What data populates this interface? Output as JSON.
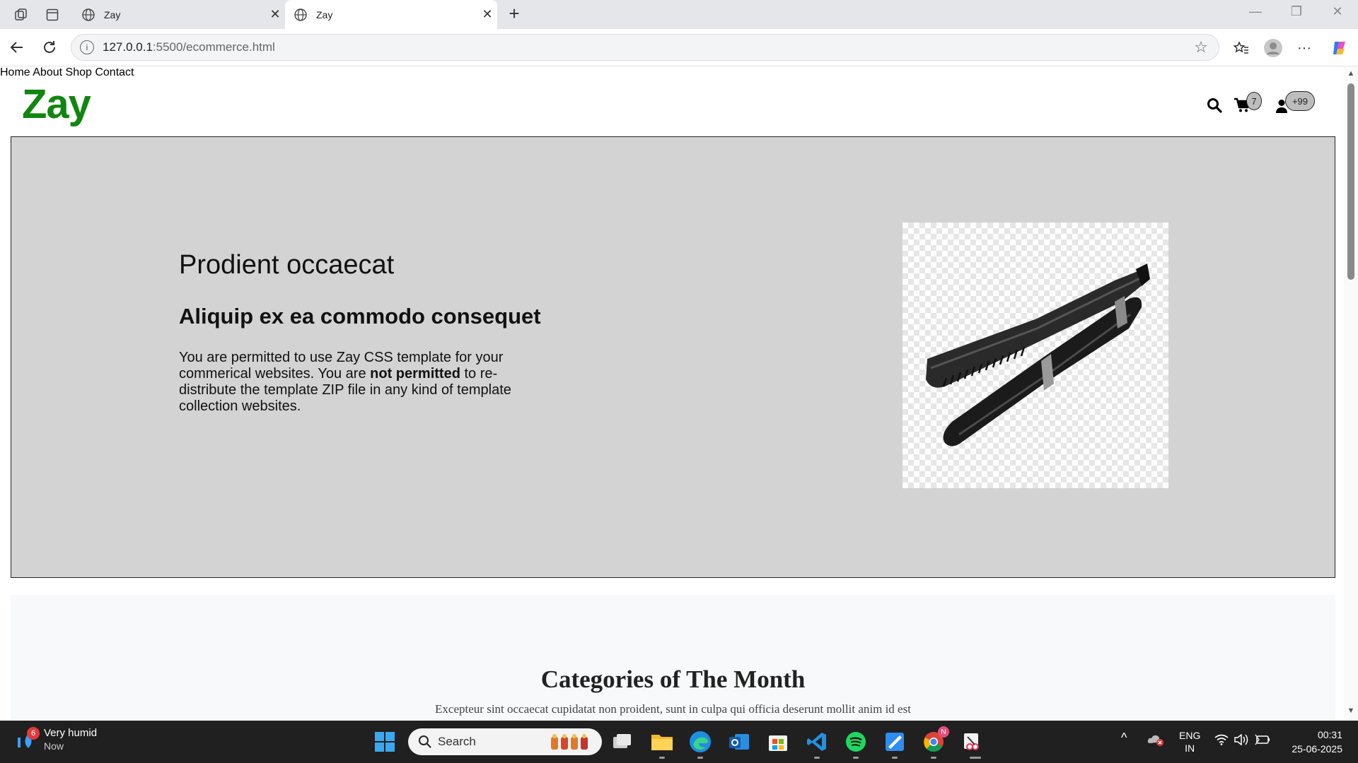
{
  "browser": {
    "tabs": [
      {
        "title": "Zay"
      },
      {
        "title": "Zay"
      }
    ],
    "url_host": "127.0.0.1",
    "url_rest": ":5500/ecommerce.html"
  },
  "site": {
    "logo": "Zay",
    "menu": [
      "Home",
      "About",
      "Shop",
      "Contact"
    ],
    "cart_count": "7",
    "user_count": "+99"
  },
  "hero": {
    "title": "Prodient occaecat",
    "subtitle": "Aliquip ex ea commodo consequet",
    "text_before": "You are permitted to use Zay CSS template for your commerical websites. You are ",
    "text_bold": "not permitted",
    "text_after": " to re-distribute the template ZIP file in any kind of template collection websites."
  },
  "categories": {
    "title": "Categories of The Month",
    "text": "Excepteur sint occaecat cupidatat non proident, sunt in culpa qui officia deserunt mollit anim id est"
  },
  "taskbar": {
    "weather_title": "Very humid",
    "weather_sub": "Now",
    "weather_badge": "6",
    "search_label": "Search",
    "lang_top": "ENG",
    "lang_bottom": "IN",
    "time": "00:31",
    "date": "25-06-2025",
    "chrome_badge": "N"
  },
  "colors": {
    "logo": "#11860f",
    "hero_bg": "#d3d3d3",
    "taskbar": "#202020"
  }
}
